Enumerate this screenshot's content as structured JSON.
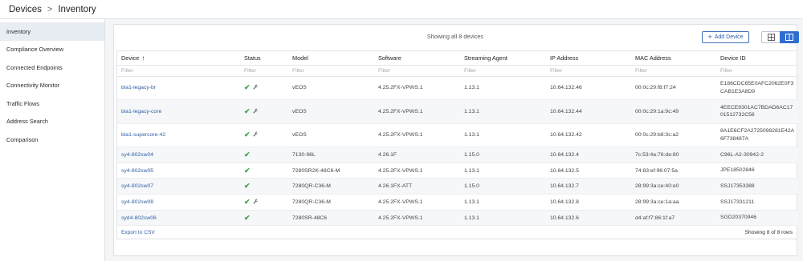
{
  "breadcrumb": {
    "root": "Devices",
    "separator": ">",
    "current": "Inventory"
  },
  "sidebar": {
    "items": [
      {
        "label": "Inventory",
        "active": true
      },
      {
        "label": "Compliance Overview",
        "active": false
      },
      {
        "label": "Connected Endpoints",
        "active": false
      },
      {
        "label": "Connectivity Monitor",
        "active": false
      },
      {
        "label": "Traffic Flows",
        "active": false
      },
      {
        "label": "Address Search",
        "active": false
      },
      {
        "label": "Comparison",
        "active": false
      }
    ]
  },
  "toolbar": {
    "showing_text": "Showing all 8 devices",
    "add_device_label": "Add Device",
    "add_icon": "+",
    "grid_view_icon": "grid-view-icon",
    "split_view_icon": "split-view-icon"
  },
  "table": {
    "columns": [
      "Device",
      "Status",
      "Model",
      "Software",
      "Streaming Agent",
      "IP Address",
      "MAC Address",
      "Device ID"
    ],
    "sort_indicator": "↑",
    "filter_placeholder": "Filter",
    "rows": [
      {
        "device": "bla1-legacy-br",
        "wrench": true,
        "model": "vEOS",
        "software": "4.25.2FX-VPWS.1",
        "agent": "1.13.1",
        "ip": "10.64.132.46",
        "mac": "00:0c:29:f8:f7:24",
        "device_id": "E186CDC65E0AFC2062E0F3CAB1E3A8D9"
      },
      {
        "device": "bla1-legacy-core",
        "wrench": true,
        "model": "vEOS",
        "software": "4.25.2FX-VPWS.1",
        "agent": "1.13.1",
        "ip": "10.64.132.44",
        "mac": "00:0c:29:1a:9c:49",
        "device_id": "4EECE9301AC7BDAD6AC1701512732C56"
      },
      {
        "device": "bla1-supercore-42",
        "wrench": true,
        "model": "vEOS",
        "software": "4.25.2FX-VPWS.1",
        "agent": "1.13.1",
        "ip": "10.64.132.42",
        "mac": "00:0c:29:b8:3c:a2",
        "device_id": "8A1E6CF2A2725098281E42A6F738487A"
      },
      {
        "device": "sy4-802sw04",
        "wrench": false,
        "model": "7130-96L",
        "software": "4.26.1F",
        "agent": "1.15.0",
        "ip": "10.64.132.4",
        "mac": "7c:53:4a:78:de:80",
        "device_id": "C96L-A2-30942-2"
      },
      {
        "device": "sy4-802sw05",
        "wrench": false,
        "model": "7280SR2K-48C6-M",
        "software": "4.25.2FX-VPWS.1",
        "agent": "1.13.1",
        "ip": "10.64.132.5",
        "mac": "74:83:ef:96:07:5a",
        "device_id": "JPE18502846"
      },
      {
        "device": "sy4-802sw07",
        "wrench": false,
        "model": "7280QR-C36-M",
        "software": "4.26.1FX-ATT",
        "agent": "1.15.0",
        "ip": "10.64.132.7",
        "mac": "28:99:3a:ce:40:e0",
        "device_id": "SSJ17353388"
      },
      {
        "device": "sy4-802sw08",
        "wrench": true,
        "model": "7280QR-C36-M",
        "software": "4.25.2FX-VPWS.1",
        "agent": "1.13.1",
        "ip": "10.64.132.8",
        "mac": "28:99:3a:ce:1a:aa",
        "device_id": "SSJ17331211"
      },
      {
        "device": "syd4-802sw06",
        "wrench": false,
        "model": "7280SR-48C6",
        "software": "4.25.2FX-VPWS.1",
        "agent": "1.13.1",
        "ip": "10.64.132.6",
        "mac": "d4:af:f7:86:1f:a7",
        "device_id": "SGD20370946"
      }
    ],
    "status_icon": "✔",
    "wrench_icon": "🔧",
    "export_label": "Export to CSV",
    "rows_label": "Showing 8 of 8 rows"
  },
  "colors": {
    "accent": "#2f6dd0",
    "link": "#2f5fa3",
    "ok": "#3aa64c"
  }
}
